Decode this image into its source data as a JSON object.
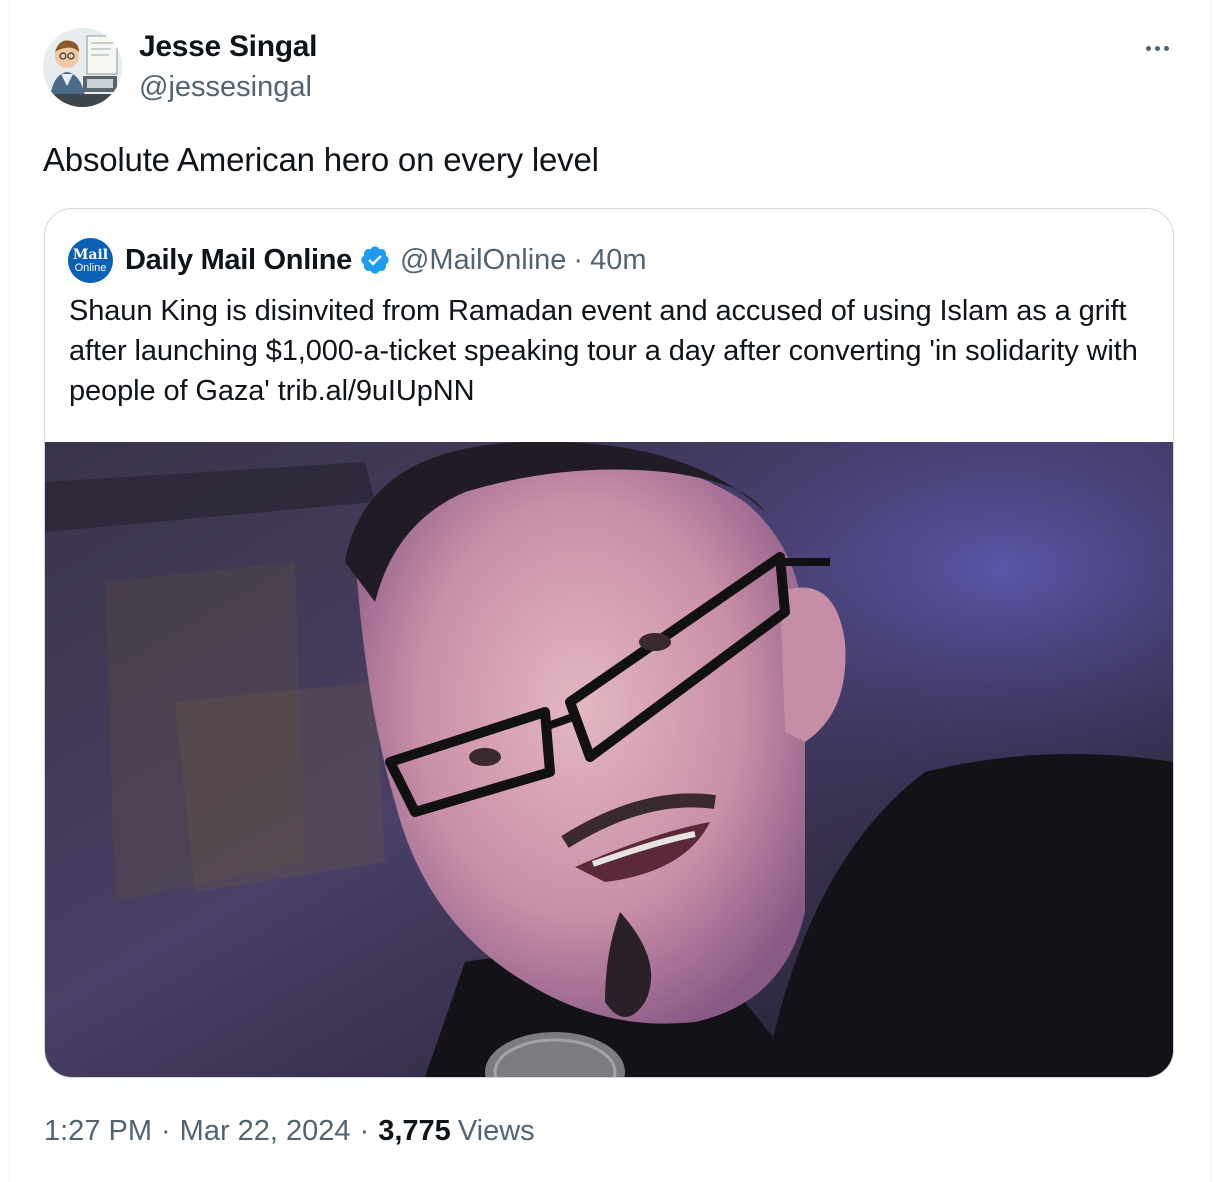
{
  "tweet": {
    "author_name": "Jesse Singal",
    "author_handle": "@jessesingal",
    "text": "Absolute American hero on every level",
    "time": "1:27 PM",
    "date": "Mar 22, 2024",
    "separator": "·",
    "views_count": "3,775",
    "views_label": "Views"
  },
  "quote": {
    "avatar_text_top": "Mail",
    "avatar_text_bottom": "Online",
    "author_name": "Daily Mail Online",
    "verified": true,
    "author_handle": "@MailOnline",
    "separator": "·",
    "time": "40m",
    "text": "Shaun King is disinvited from Ramadan event and accused of using Islam as a grift after launching $1,000-a-ticket speaking tour a day after converting 'in solidarity with people of Gaza' trib.al/9uIUpNN"
  },
  "icons": {
    "more": "more-horizontal-icon",
    "verified": "verified-badge-icon"
  },
  "colors": {
    "text_primary": "#0f1419",
    "text_secondary": "#536471",
    "border": "#cfd9de",
    "verified_blue": "#1d9bf0",
    "mail_online_blue": "#0a60b6"
  }
}
